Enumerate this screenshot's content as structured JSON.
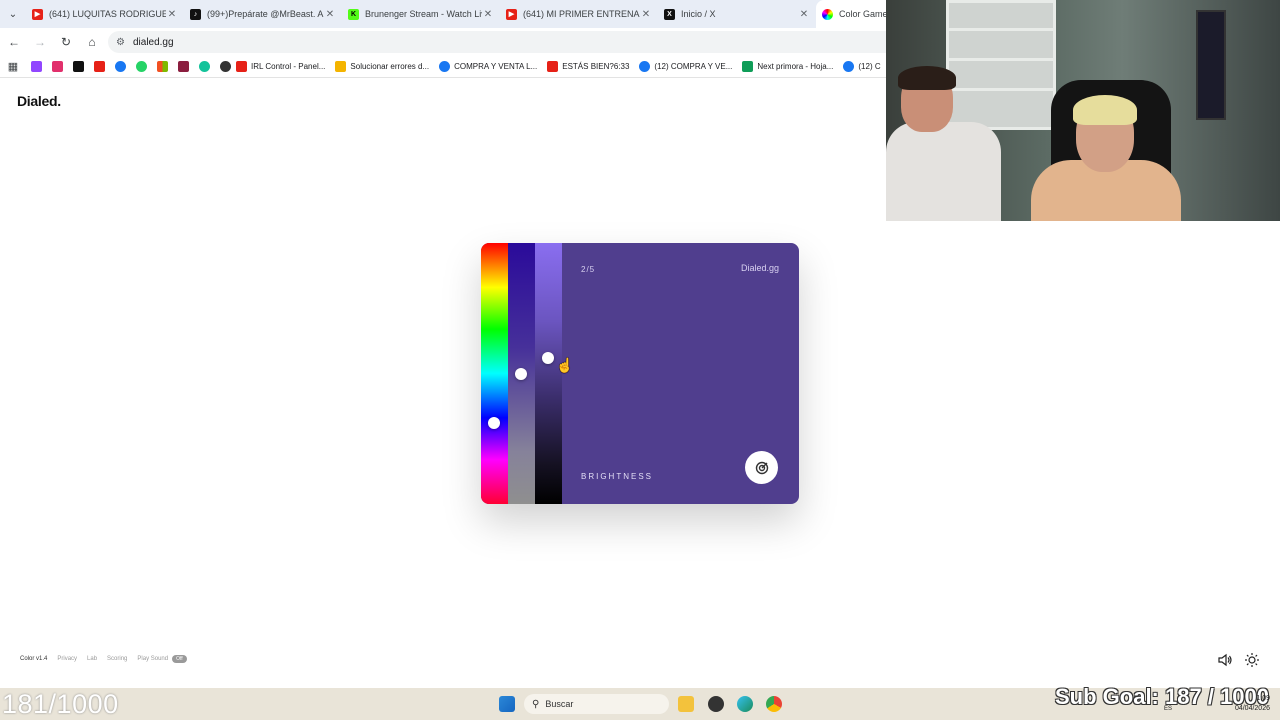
{
  "browser": {
    "tabs": [
      {
        "label": "(641) LUQUITAS RODRIGUEZ Y",
        "icon": "youtube-icon",
        "color": "#e62117"
      },
      {
        "label": "(99+)Prepárate @MrBeast. Aho",
        "icon": "tiktok-icon",
        "color": "#111111"
      },
      {
        "label": "Brunenger Stream - Watch Live",
        "icon": "kick-icon",
        "color": "#53fc18"
      },
      {
        "label": "(641) MI PRIMER ENTRENAMIEN",
        "icon": "youtube-icon",
        "color": "#e62117"
      },
      {
        "label": "Inicio / X",
        "icon": "x-icon",
        "color": "#111111"
      },
      {
        "label": "Color Game -",
        "icon": "color-wheel-icon",
        "color": "#e040a0"
      }
    ],
    "address": "dialed.gg",
    "bookmarks": [
      {
        "label": "IRL Control - Panel...",
        "color": "#e62117"
      },
      {
        "label": "Solucionar errores d...",
        "color": "#f4b400"
      },
      {
        "label": "COMPRA Y VENTA L...",
        "color": "#1877f2"
      },
      {
        "label": "ESTÁS BIEN?6:33",
        "color": "#e62117"
      },
      {
        "label": "(12) COMPRA Y VE...",
        "color": "#1877f2"
      },
      {
        "label": "Next primora - Hoja...",
        "color": "#0f9d58"
      },
      {
        "label": "(12) C",
        "color": "#1877f2"
      }
    ],
    "bookmark_icons": [
      "#9146ff",
      "#e1306c",
      "#111111",
      "#e62117",
      "#1877f2",
      "#25d366",
      "#f25022",
      "#8b1e3f",
      "#13c39a",
      "#333333"
    ]
  },
  "page": {
    "logo": "Dialed.",
    "card": {
      "step": "2/5",
      "brand": "Dialed.gg",
      "mode": "BRIGHTNESS",
      "color": "#503e8e",
      "hue_level": 0.69,
      "saturation_level": 0.5,
      "brightness_level": 0.44
    },
    "footer": {
      "version": "Color v1.4",
      "links": [
        "Privacy",
        "Lab",
        "Scoring",
        "Play Sound"
      ],
      "badge": "Off"
    }
  },
  "stream": {
    "counter": "181/1000",
    "subgoal": "Sub Goal: 187 / 1000"
  },
  "taskbar": {
    "search_placeholder": "Buscar",
    "lang": "ES",
    "time": "1:09",
    "date": "04/04/2026"
  }
}
